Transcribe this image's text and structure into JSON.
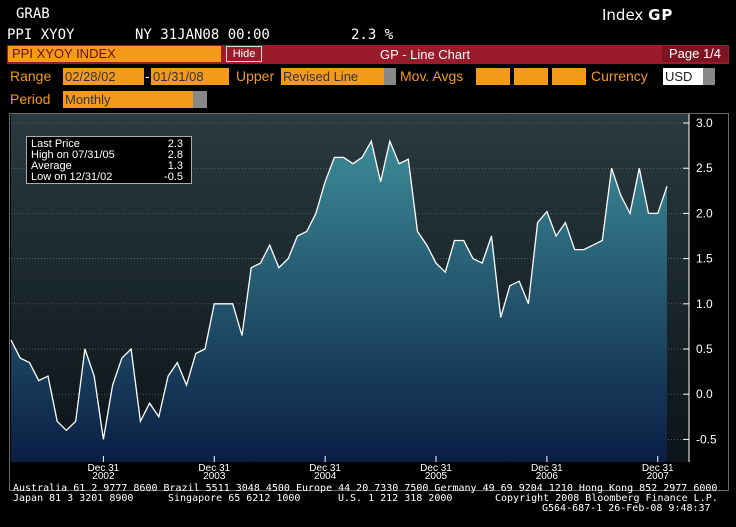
{
  "header": {
    "grab_label": "GRAB",
    "index_label": "Index",
    "index_code": "GP",
    "ticker": "PPI XYOY",
    "location_date": "NY 31JAN08 00:00",
    "last_value": "2.3 %"
  },
  "toolbar": {
    "ticker_field": "PPI XYOY INDEX",
    "hide_label": "Hide",
    "chart_title": "GP - Line Chart",
    "page_label": "Page 1/4"
  },
  "controls": {
    "range_label": "Range",
    "range_start": "02/28/02",
    "range_separator": "-",
    "range_end": "01/31/08",
    "upper_label": "Upper",
    "upper_value": "Revised Line",
    "mov_avgs_label": "Mov. Avgs",
    "currency_label": "Currency",
    "currency_value": "USD",
    "period_label": "Period",
    "period_value": "Monthly"
  },
  "stats": {
    "rows": [
      {
        "label": "Last Price",
        "value": "2.3"
      },
      {
        "label": "High on 07/31/05",
        "value": "2.8"
      },
      {
        "label": "Average",
        "value": "1.3"
      },
      {
        "label": "Low on 12/31/02",
        "value": "-0.5"
      }
    ]
  },
  "footer": {
    "line1": "Australia 61 2 9777 8600 Brazil 5511 3048 4500 Europe 44 20 7330 7500 Germany 49 69 9204 1210 Hong Kong 852 2977 6000",
    "line2_left": "Japan 81 3 3201 8900",
    "line2_mid1": "Singapore 65 6212 1000",
    "line2_mid2": "U.S. 1 212 318 2000",
    "line2_right": "Copyright 2008 Bloomberg Finance L.P.",
    "line3": "G564-687-1 26-Feb-08  9:48:37"
  },
  "colors": {
    "orange": "#f39a1b",
    "red_bar": "#9a1b2a",
    "line": "#ffffff",
    "area_top": "#3c8a96",
    "area_bottom": "#0a1e44"
  },
  "chart_data": {
    "type": "area",
    "ylim": [
      -0.75,
      3.1
    ],
    "yticks": [
      3.0,
      2.5,
      2.0,
      1.5,
      1.0,
      0.5,
      0.0,
      -0.5
    ],
    "ytick_labels": [
      "3.0",
      "2.5",
      "2.0",
      "1.5",
      "1.0",
      "0.5",
      "0.0",
      "-0.5"
    ],
    "xtick_labels": [
      {
        "top": "Dec 31",
        "bottom": "2002",
        "index": 10
      },
      {
        "top": "Dec 31",
        "bottom": "2003",
        "index": 22
      },
      {
        "top": "Dec 31",
        "bottom": "2004",
        "index": 34
      },
      {
        "top": "Dec 31",
        "bottom": "2005",
        "index": 46
      },
      {
        "top": "Dec 31",
        "bottom": "2006",
        "index": 58
      },
      {
        "top": "Dec 31",
        "bottom": "2007",
        "index": 70
      }
    ],
    "series": [
      {
        "values": [
          0.6,
          0.4,
          0.35,
          0.15,
          0.2,
          -0.3,
          -0.4,
          -0.3,
          0.5,
          0.2,
          -0.5,
          0.1,
          0.4,
          0.5,
          -0.3,
          -0.1,
          -0.25,
          0.2,
          0.35,
          0.1,
          0.45,
          0.5,
          1.0,
          1.0,
          1.0,
          0.65,
          1.4,
          1.45,
          1.65,
          1.4,
          1.5,
          1.75,
          1.8,
          2.0,
          2.35,
          2.62,
          2.62,
          2.55,
          2.62,
          2.8,
          2.35,
          2.8,
          2.55,
          2.6,
          1.8,
          1.65,
          1.45,
          1.35,
          1.7,
          1.7,
          1.5,
          1.45,
          1.75,
          0.85,
          1.2,
          1.25,
          1.0,
          1.9,
          2.02,
          1.75,
          1.9,
          1.6,
          1.6,
          1.65,
          1.7,
          2.5,
          2.2,
          2.0,
          2.5,
          2.0,
          2.0,
          2.3
        ]
      }
    ]
  }
}
